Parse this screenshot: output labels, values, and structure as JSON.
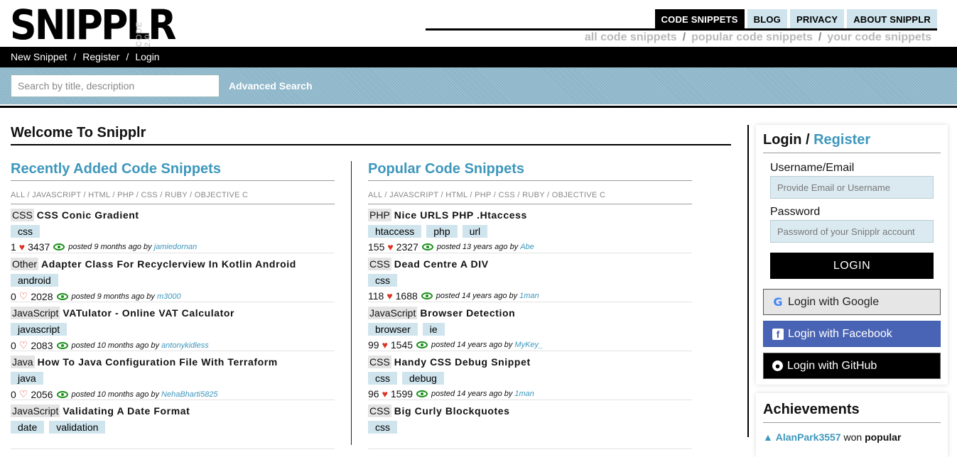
{
  "logo": {
    "text": "SNIPPLR",
    "sub": "CODE 2.0"
  },
  "topnav": [
    {
      "label": "CODE SNIPPETS",
      "active": true
    },
    {
      "label": "BLOG"
    },
    {
      "label": "PRIVACY"
    },
    {
      "label": "ABOUT SNIPPLR"
    }
  ],
  "subnav": [
    "all code snippets",
    "popular code snippets",
    "your code snippets"
  ],
  "blackbar": [
    "New Snippet",
    "Register",
    "Login"
  ],
  "search": {
    "placeholder": "Search by title, description",
    "advanced": "Advanced Search"
  },
  "welcome": "Welcome To Snipplr",
  "filters": [
    "ALL",
    "JAVASCRIPT",
    "HTML",
    "PHP",
    "CSS",
    "RUBY",
    "OBJECTIVE C"
  ],
  "recent": {
    "title": "Recently Added Code Snippets",
    "items": [
      {
        "lang": "CSS",
        "title": "CSS Conic Gradient",
        "tags": [
          "css"
        ],
        "likes": "1",
        "liked": true,
        "views": "3437",
        "posted": "posted 9 months ago by",
        "user": "jamiedornan"
      },
      {
        "lang": "Other",
        "title": "Adapter Class For Recyclerview In Kotlin Android",
        "tags": [
          "android"
        ],
        "likes": "0",
        "liked": false,
        "views": "2028",
        "posted": "posted 9 months ago by",
        "user": "m3000"
      },
      {
        "lang": "JavaScript",
        "title": "VATulator - Online VAT Calculator",
        "tags": [
          "javascript"
        ],
        "likes": "0",
        "liked": false,
        "views": "2083",
        "posted": "posted 10 months ago by",
        "user": "antonykidless"
      },
      {
        "lang": "Java",
        "title": "How To Java Configuration File With Terraform",
        "tags": [
          "java"
        ],
        "likes": "0",
        "liked": false,
        "views": "2056",
        "posted": "posted 10 months ago by",
        "user": "NehaBharti5825"
      },
      {
        "lang": "JavaScript",
        "title": "Validating A Date Format",
        "tags": [
          "date",
          "validation"
        ]
      }
    ]
  },
  "popular": {
    "title": "Popular Code Snippets",
    "items": [
      {
        "lang": "PHP",
        "title": "Nice URLS PHP .Htaccess",
        "tags": [
          "htaccess",
          "php",
          "url"
        ],
        "likes": "155",
        "liked": true,
        "views": "2327",
        "posted": "posted 13 years ago by",
        "user": "Abe"
      },
      {
        "lang": "CSS",
        "title": "Dead Centre A DIV",
        "tags": [
          "css"
        ],
        "likes": "118",
        "liked": true,
        "views": "1688",
        "posted": "posted 14 years ago by",
        "user": "1man"
      },
      {
        "lang": "JavaScript",
        "title": "Browser Detection",
        "tags": [
          "browser",
          "ie"
        ],
        "likes": "99",
        "liked": true,
        "views": "1545",
        "posted": "posted 14 years ago by",
        "user": "MyKey_"
      },
      {
        "lang": "CSS",
        "title": "Handy CSS Debug Snippet",
        "tags": [
          "css",
          "debug"
        ],
        "likes": "96",
        "liked": true,
        "views": "1599",
        "posted": "posted 14 years ago by",
        "user": "1man"
      },
      {
        "lang": "CSS",
        "title": "Big Curly Blockquotes",
        "tags": [
          "css"
        ]
      }
    ]
  },
  "login": {
    "title": "Login",
    "register": "Register",
    "username_label": "Username/Email",
    "username_placeholder": "Provide Email or Username",
    "password_label": "Password",
    "password_placeholder": "Password of your Snipplr account",
    "button": "LOGIN",
    "google": "Login with Google",
    "facebook": "Login with Facebook",
    "github": "Login with GitHub"
  },
  "achievements": {
    "title": "Achievements",
    "user": "AlanPark3557",
    "action": "won",
    "badge": "popular"
  },
  "colors": {
    "accent": "#3d97bc",
    "tag_bg": "#cfe4ec",
    "heart": "#dd3322",
    "eye": "#1a8f1a"
  }
}
